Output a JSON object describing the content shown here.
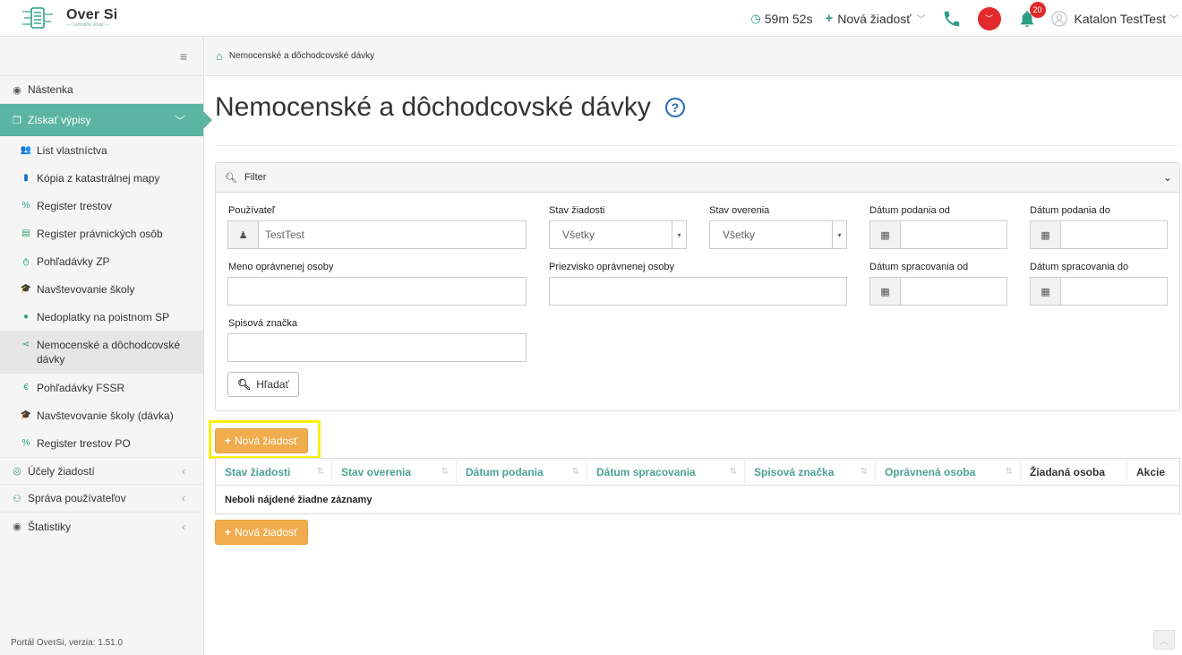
{
  "brand": {
    "name": "Over Si",
    "subtitle": "— Centrálne údaje —"
  },
  "topbar": {
    "timer": "59m 52s",
    "new_request": "Nová žiadosť",
    "notifications_count": "20",
    "user_name": "Katalon TestTest"
  },
  "breadcrumb": {
    "current": "Nemocenské a dôchodcovské dávky"
  },
  "sidebar": {
    "items": [
      {
        "label": "Nástenka"
      },
      {
        "label": "Získať výpisy"
      },
      {
        "label": "Účely žiadostí"
      },
      {
        "label": "Správa používateľov"
      },
      {
        "label": "Štatistiky"
      }
    ],
    "subitems": [
      {
        "label": "List vlastníctva"
      },
      {
        "label": "Kópia z katastrálnej mapy"
      },
      {
        "label": "Register trestov"
      },
      {
        "label": "Register právnických osôb"
      },
      {
        "label": "Pohľadávky ZP"
      },
      {
        "label": "Navštevovanie školy"
      },
      {
        "label": "Nedoplatky na poistnom SP"
      },
      {
        "label": "Nemocenské a dôchodcovské dávky"
      },
      {
        "label": "Pohľadávky FSSR"
      },
      {
        "label": "Navštevovanie školy (dávka)"
      },
      {
        "label": "Register trestov PO"
      }
    ],
    "footer": "Portál OverSi, verzia: 1.51.0"
  },
  "page": {
    "title": "Nemocenské a dôchodcovské dávky"
  },
  "filter": {
    "header": "Filter",
    "user_label": "Používateľ",
    "user_value": "TestTest",
    "state_label": "Stav žiadosti",
    "state_value": "Všetky",
    "verify_label": "Stav overenia",
    "verify_value": "Všetky",
    "submit_from_label": "Dátum podania od",
    "submit_to_label": "Dátum podania do",
    "first_name_label": "Meno oprávnenej osoby",
    "last_name_label": "Priezvisko oprávnenej osoby",
    "process_from_label": "Dátum spracovania od",
    "process_to_label": "Dátum spracovania do",
    "file_label": "Spisová značka",
    "search_button": "Hľadať"
  },
  "actions": {
    "new_request": "Nová žiadosť"
  },
  "table": {
    "columns": [
      "Stav žiadosti",
      "Stav overenia",
      "Dátum podania",
      "Dátum spracovania",
      "Spisová značka",
      "Oprávnená osoba",
      "Žiadaná osoba",
      "Akcie"
    ],
    "empty": "Neboli nájdené žiadne záznamy"
  }
}
